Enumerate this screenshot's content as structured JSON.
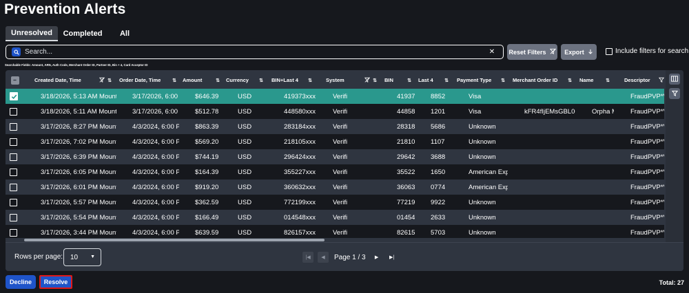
{
  "page": {
    "title": "Prevention Alerts"
  },
  "tabs": [
    {
      "label": "Unresolved",
      "active": true
    },
    {
      "label": "Completed",
      "active": false
    },
    {
      "label": "All",
      "active": false
    }
  ],
  "search": {
    "placeholder": "Search...",
    "value": "",
    "hint": "Searchable Fields: Amount, ARN, Auth Code, Merchant Order ID, Partner ID, Bin + 4, Card Acceptor ID"
  },
  "toolbar": {
    "reset_label": "Reset Filters",
    "export_label": "Export",
    "include_filters_label": "Include filters for search",
    "include_filters_checked": false
  },
  "table": {
    "columns": [
      {
        "label": "Created Date, Time",
        "filter_icon": "filter-off-icon"
      },
      {
        "label": "Order Date, Time"
      },
      {
        "label": "Amount"
      },
      {
        "label": "Currency"
      },
      {
        "label": "BIN+Last 4"
      },
      {
        "label": "System",
        "filter_icon": "filter-off-icon"
      },
      {
        "label": "BIN"
      },
      {
        "label": "Last 4"
      },
      {
        "label": "Payment Type"
      },
      {
        "label": "Merchant Order ID"
      },
      {
        "label": "Name"
      },
      {
        "label": "Descriptor",
        "filter_icon": "filter-icon"
      }
    ],
    "rows": [
      {
        "selected": true,
        "cells": [
          "3/18/2026, 5:13 AM Mount",
          "3/17/2026, 6:00 I",
          "$646.39",
          "USD",
          "419373xxxx",
          "Verifi",
          "41937",
          "8852",
          "Visa",
          "",
          "",
          "FraudPVP*V"
        ]
      },
      {
        "selected": false,
        "cells": [
          "3/18/2026, 5:11 AM Mount",
          "3/17/2026, 6:00 I",
          "$512.78",
          "USD",
          "448580xxxx",
          "Verifi",
          "44858",
          "1201",
          "Visa",
          "kFR4fIjEMsGBL0O",
          "Orpha M",
          "FraudPVP*V"
        ]
      },
      {
        "selected": false,
        "cells": [
          "3/17/2026, 8:27 PM Mount",
          "4/3/2024, 6:00 Pl",
          "$863.39",
          "USD",
          "283184xxxx",
          "Verifi",
          "28318",
          "5686",
          "Unknown",
          "",
          "",
          "FraudPVP*V"
        ]
      },
      {
        "selected": false,
        "cells": [
          "3/17/2026, 7:02 PM Mount",
          "4/3/2024, 6:00 Pl",
          "$569.20",
          "USD",
          "218105xxxx",
          "Verifi",
          "21810",
          "1107",
          "Unknown",
          "",
          "",
          "FraudPVP*V"
        ]
      },
      {
        "selected": false,
        "cells": [
          "3/17/2026, 6:39 PM Mount",
          "4/3/2024, 6:00 Pl",
          "$744.19",
          "USD",
          "296424xxxx",
          "Verifi",
          "29642",
          "3688",
          "Unknown",
          "",
          "",
          "FraudPVP*V"
        ]
      },
      {
        "selected": false,
        "cells": [
          "3/17/2026, 6:05 PM Mount",
          "4/3/2024, 6:00 Pl",
          "$164.39",
          "USD",
          "355227xxxx",
          "Verifi",
          "35522",
          "1650",
          "American Expr",
          "",
          "",
          "FraudPVP*V"
        ]
      },
      {
        "selected": false,
        "cells": [
          "3/17/2026, 6:01 PM Mount",
          "4/3/2024, 6:00 Pl",
          "$919.20",
          "USD",
          "360632xxxx",
          "Verifi",
          "36063",
          "0774",
          "American Expr",
          "",
          "",
          "FraudPVP*V"
        ]
      },
      {
        "selected": false,
        "cells": [
          "3/17/2026, 5:57 PM Mount",
          "4/3/2024, 6:00 Pl",
          "$362.59",
          "USD",
          "772199xxxx",
          "Verifi",
          "77219",
          "9922",
          "Unknown",
          "",
          "",
          "FraudPVP*V"
        ]
      },
      {
        "selected": false,
        "cells": [
          "3/17/2026, 5:54 PM Mount",
          "4/3/2024, 6:00 Pl",
          "$166.49",
          "USD",
          "014548xxxx",
          "Verifi",
          "01454",
          "2633",
          "Unknown",
          "",
          "",
          "FraudPVP*V"
        ]
      },
      {
        "selected": false,
        "cells": [
          "3/17/2026, 3:44 PM Mount",
          "4/3/2024, 6:00 Pl",
          "$639.59",
          "USD",
          "826157xxxx",
          "Verifi",
          "82615",
          "5703",
          "Unknown",
          "",
          "",
          "FraudPVP*V"
        ]
      }
    ]
  },
  "pagination": {
    "rows_per_page_label": "Rows per page:",
    "rows_per_page": "10",
    "page_text": "Page 1 / 3"
  },
  "actions": {
    "decline_label": "Decline",
    "resolve_label": "Resolve",
    "total_text": "Total: 27"
  },
  "colors": {
    "background": "#16181d",
    "panel": "#2f3540",
    "selected_row": "#2a988d",
    "primary_button": "#1f54c9",
    "secondary_button": "#6c7280",
    "highlight_border": "#e01818"
  }
}
